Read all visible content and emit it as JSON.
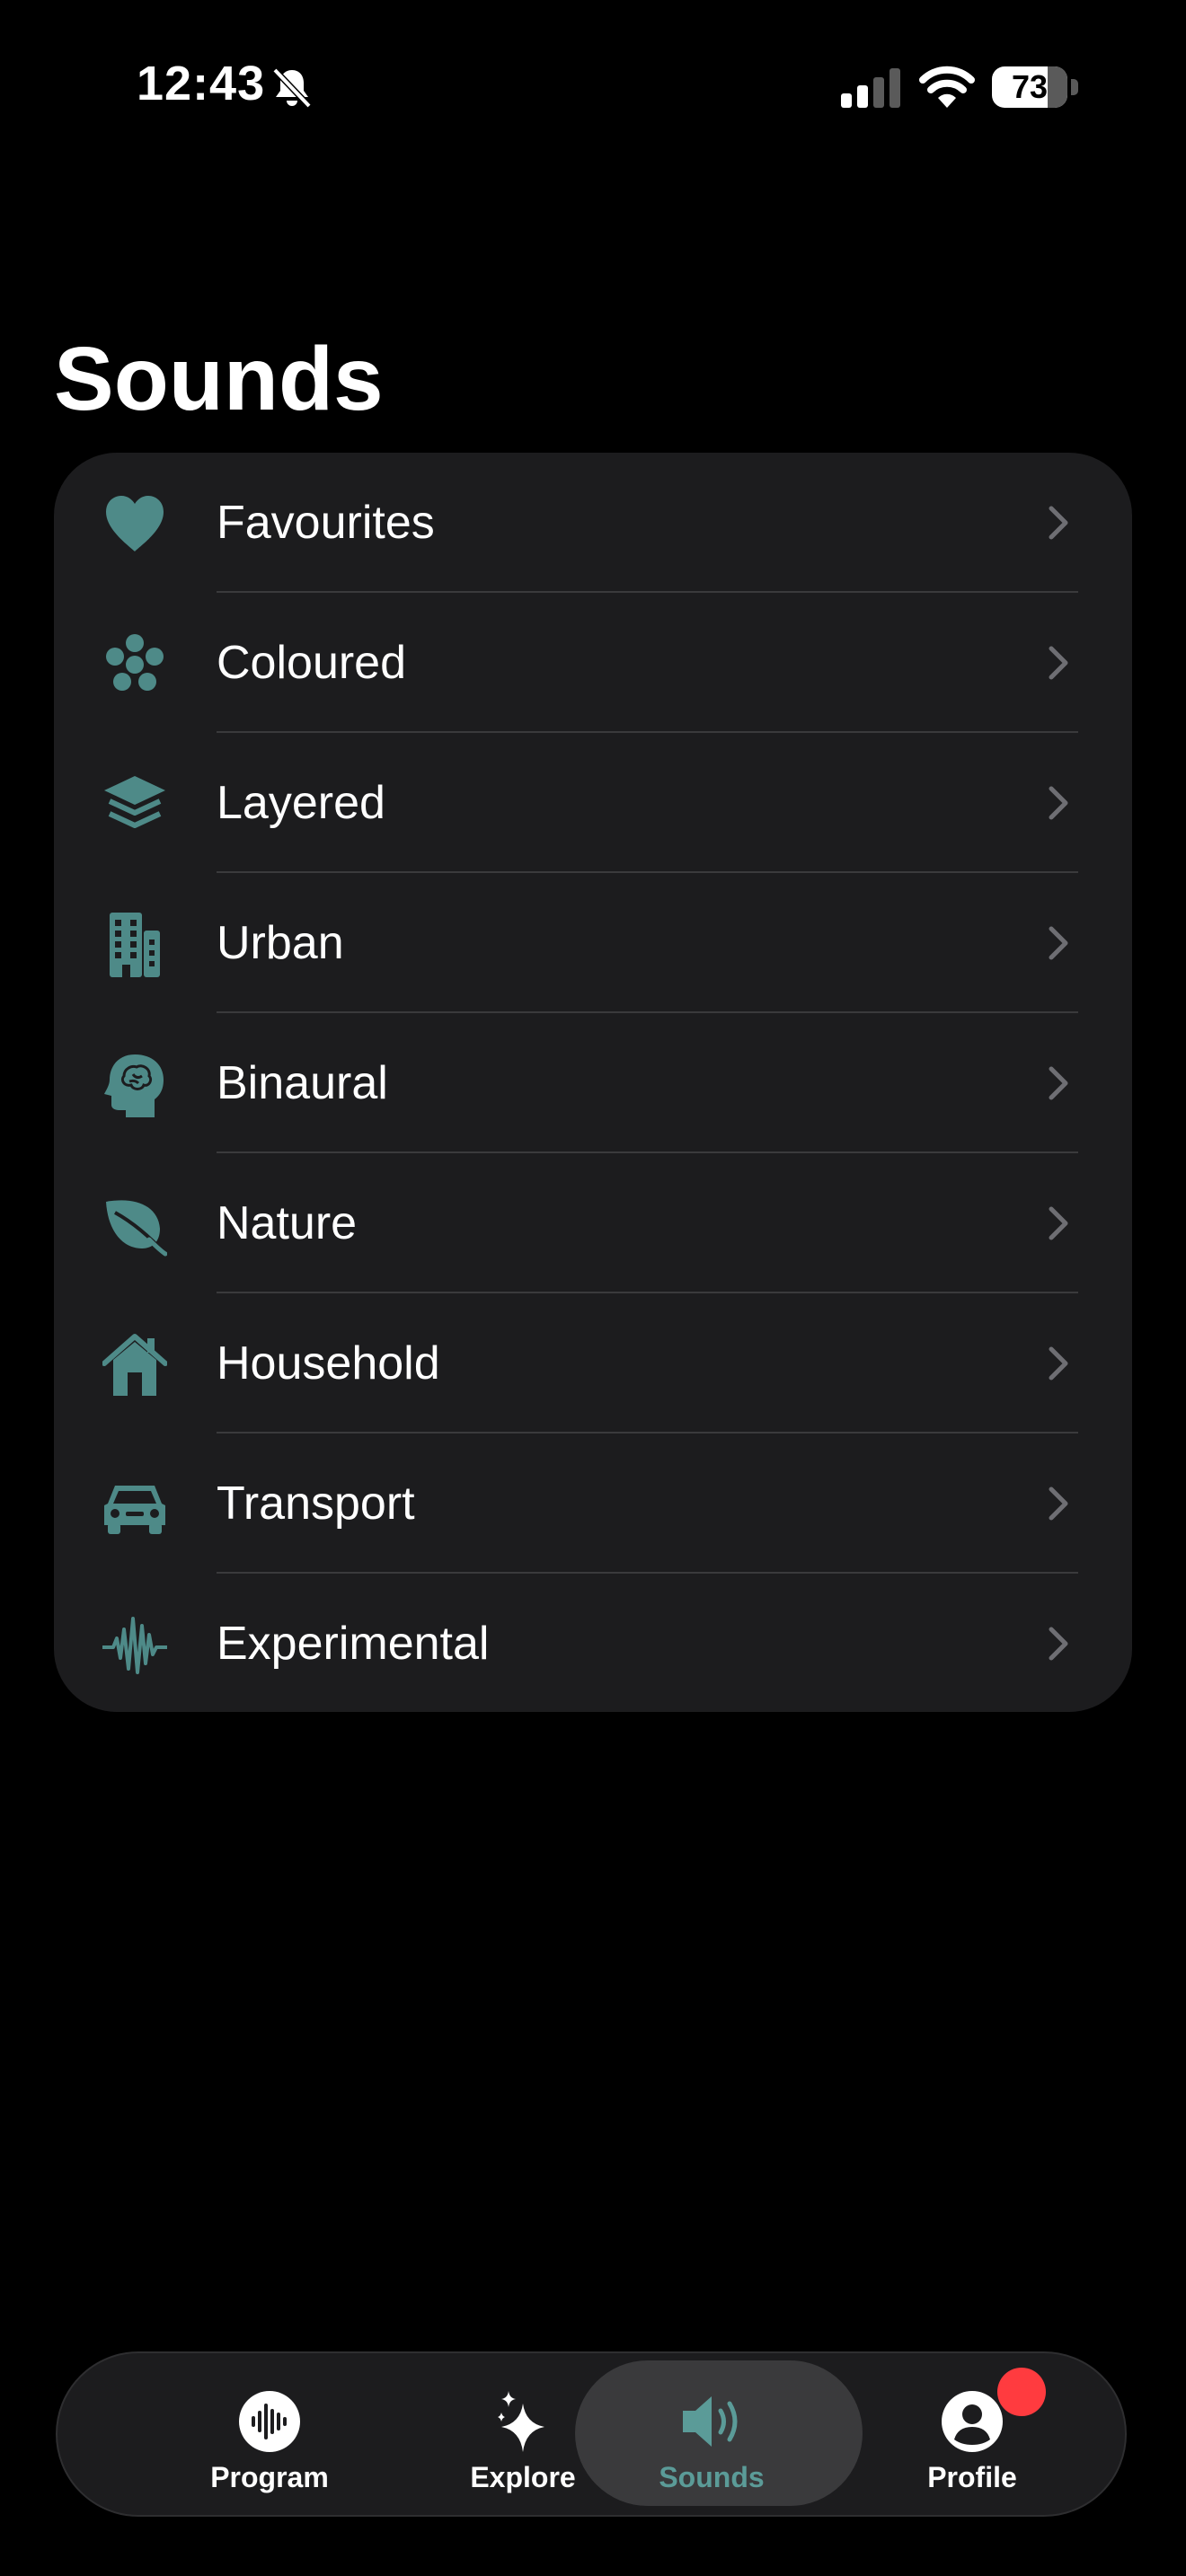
{
  "status_bar": {
    "time": "12:43",
    "battery": "73"
  },
  "page": {
    "title": "Sounds"
  },
  "colors": {
    "accent": "#4e8a88",
    "card_bg": "#1c1c1e",
    "badge": "#ff3b3f",
    "active_tab": "#5b9b98"
  },
  "categories": [
    {
      "label": "Favourites",
      "icon": "heart-icon"
    },
    {
      "label": "Coloured",
      "icon": "flower-icon"
    },
    {
      "label": "Layered",
      "icon": "layers-icon"
    },
    {
      "label": "Urban",
      "icon": "building-icon"
    },
    {
      "label": "Binaural",
      "icon": "brain-head-icon"
    },
    {
      "label": "Nature",
      "icon": "leaf-icon"
    },
    {
      "label": "Household",
      "icon": "house-icon"
    },
    {
      "label": "Transport",
      "icon": "car-icon"
    },
    {
      "label": "Experimental",
      "icon": "waveform-icon"
    }
  ],
  "tabs": [
    {
      "label": "Program",
      "icon": "waveform-circle-icon",
      "active": false
    },
    {
      "label": "Explore",
      "icon": "sparkles-icon",
      "active": false
    },
    {
      "label": "Sounds",
      "icon": "speaker-icon",
      "active": true
    },
    {
      "label": "Profile",
      "icon": "person-circle-icon",
      "active": false,
      "badge": true
    }
  ]
}
